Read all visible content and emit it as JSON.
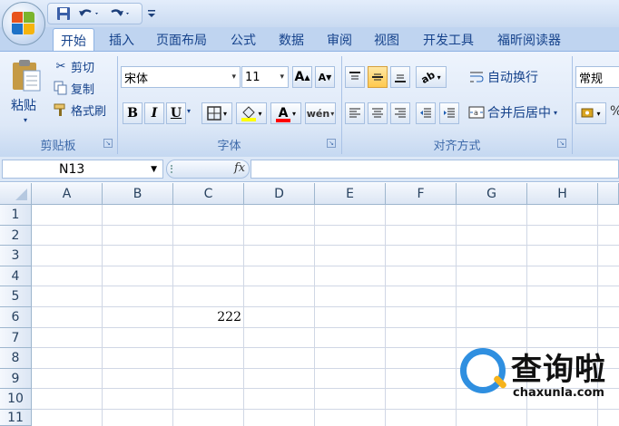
{
  "quick_access": {
    "save_icon": "save-icon",
    "undo_icon": "undo-icon",
    "redo_icon": "redo-icon"
  },
  "tabs": [
    {
      "label": "开始",
      "active": true
    },
    {
      "label": "插入"
    },
    {
      "label": "页面布局"
    },
    {
      "label": "公式"
    },
    {
      "label": "数据"
    },
    {
      "label": "审阅"
    },
    {
      "label": "视图"
    },
    {
      "label": "开发工具"
    },
    {
      "label": "福昕阅读器"
    }
  ],
  "clipboard": {
    "paste_label": "粘贴",
    "cut_label": "剪切",
    "copy_label": "复制",
    "format_painter_label": "格式刷",
    "group_label": "剪贴板"
  },
  "font": {
    "font_name": "宋体",
    "font_size": "11",
    "bold": "B",
    "italic": "I",
    "underline": "U",
    "group_label": "字体",
    "fill_color": "#ffff00",
    "font_color": "#ff0000"
  },
  "alignment": {
    "wrap_text_label": "自动换行",
    "merge_center_label": "合并后居中",
    "group_label": "对齐方式"
  },
  "number": {
    "format_value": "常规"
  },
  "formula_bar": {
    "name_box": "N13",
    "fx_label": "fx",
    "formula": ""
  },
  "grid": {
    "columns": [
      "A",
      "B",
      "C",
      "D",
      "E",
      "F",
      "G",
      "H"
    ],
    "rows": [
      "1",
      "2",
      "3",
      "4",
      "5",
      "6",
      "7",
      "8",
      "9",
      "10",
      "11"
    ],
    "cells": {
      "C6": "222"
    }
  },
  "watermark": {
    "text": "查询啦",
    "url": "chaxunla.com"
  }
}
